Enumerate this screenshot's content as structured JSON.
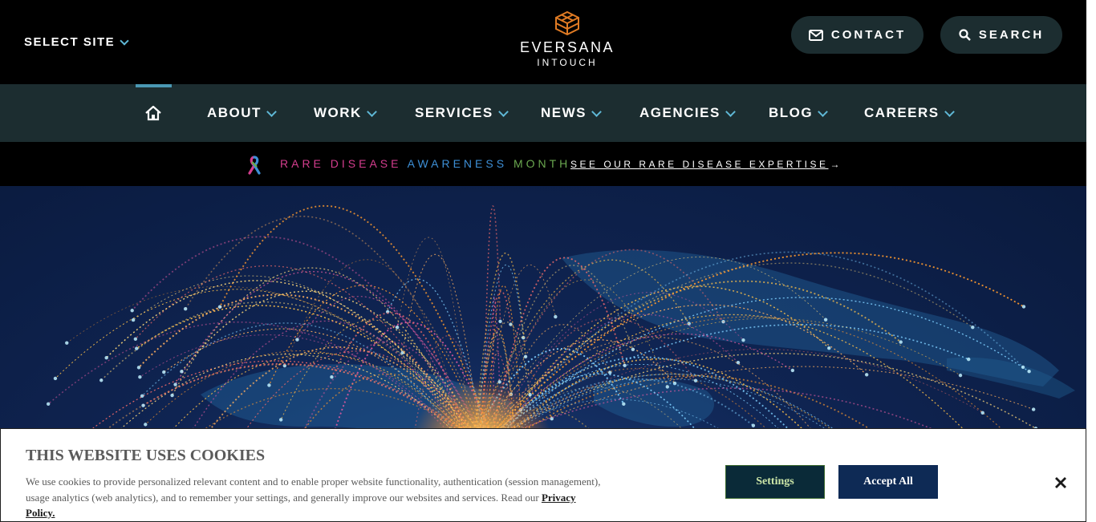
{
  "header": {
    "select_site": "SELECT SITE",
    "logo_main": "EVERSANA",
    "logo_sub": "INTOUCH",
    "contact_label": "CONTACT",
    "search_label": "SEARCH"
  },
  "nav": {
    "items": [
      {
        "label": "ABOUT"
      },
      {
        "label": "WORK"
      },
      {
        "label": "SERVICES"
      },
      {
        "label": "NEWS"
      },
      {
        "label": "AGENCIES"
      },
      {
        "label": "BLOG"
      },
      {
        "label": "CAREERS"
      }
    ]
  },
  "announcement": {
    "rare": "RARE",
    "disease": "DISEASE",
    "awareness": "AWARENESS",
    "month": "MONTH",
    "link": "SEE OUR RARE DISEASE EXPERTISE"
  },
  "cookie": {
    "title": "THIS WEBSITE USES COOKIES",
    "body": "We use cookies to provide personalized relevant content and to enable proper website functionality, authentication (session management), usage analytics (web analytics), and to remember your settings, and generally improve our websites and services. Read our",
    "privacy_link": "Privacy Policy.",
    "settings_label": "Settings",
    "accept_label": "Accept All"
  },
  "colors": {
    "header_bg": "#000000",
    "nav_bg": "#1c2d30",
    "accent": "#4a98b3",
    "logo_orange": "#e07b24",
    "rare_pink": "#d43d8e",
    "awareness_blue": "#3d8fd6",
    "month_green": "#6aa84f",
    "accept_bg": "#0e2a55"
  },
  "icons": {
    "contact": "mail-icon",
    "search": "search-icon",
    "home": "home-icon",
    "ribbon": "awareness-ribbon-icon",
    "close": "close-icon"
  }
}
